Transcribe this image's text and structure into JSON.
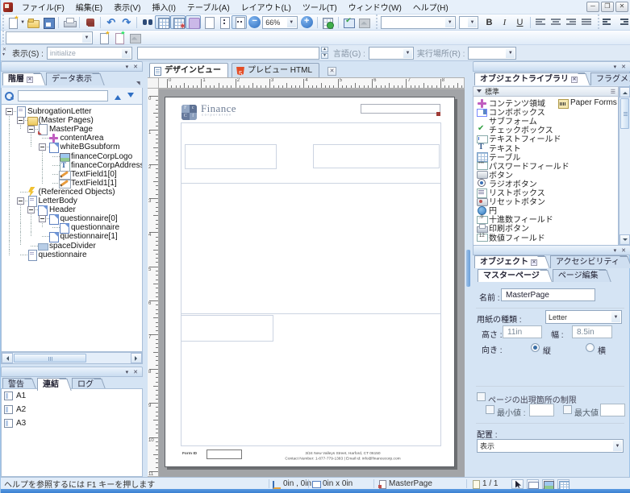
{
  "menu": {
    "items": [
      "ファイル(F)",
      "編集(E)",
      "表示(V)",
      "挿入(I)",
      "テーブル(A)",
      "レイアウト(L)",
      "ツール(T)",
      "ウィンドウ(W)",
      "ヘルプ(H)"
    ]
  },
  "toolbar": {
    "zoom_value": "66%",
    "bold": "B",
    "italic": "I",
    "underline": "U"
  },
  "script_bar": {
    "show_label": "表示(S) :",
    "show_value": "initialize",
    "language_label": "言語(G) :",
    "runat_label": "実行場所(R) :"
  },
  "hierarchy_panel": {
    "tabs": [
      "階層",
      "データ表示"
    ],
    "active_tab": 0,
    "tree": [
      {
        "label": "SubrogationLetter",
        "level": 1,
        "icon": "doc",
        "exp": true
      },
      {
        "label": "(Master Pages)",
        "level": 2,
        "icon": "folder",
        "exp": true
      },
      {
        "label": "MasterPage",
        "level": 3,
        "icon": "mpage",
        "exp": true
      },
      {
        "label": "contentArea",
        "level": 4,
        "icon": "carea",
        "exp": false
      },
      {
        "label": "whiteBGsubform",
        "level": 4,
        "icon": "subform",
        "exp": true
      },
      {
        "label": "financeCorpLogo",
        "level": 5,
        "icon": "img",
        "exp": false
      },
      {
        "label": "financeCorpAddress",
        "level": 5,
        "icon": "taddr",
        "exp": false
      },
      {
        "label": "TextField1[0]",
        "level": 5,
        "icon": "tfield",
        "exp": false
      },
      {
        "label": "TextField1[1]",
        "level": 5,
        "icon": "tfield",
        "exp": false
      },
      {
        "label": "(Referenced Objects)",
        "level": 2,
        "icon": "bolt",
        "exp": false
      },
      {
        "label": "LetterBody",
        "level": 2,
        "icon": "doc",
        "exp": true
      },
      {
        "label": "Header",
        "level": 3,
        "icon": "subform",
        "exp": true
      },
      {
        "label": "questionnaire[0]",
        "level": 4,
        "icon": "subform",
        "exp": true
      },
      {
        "label": "questionnaire",
        "level": 5,
        "icon": "subform",
        "exp": false
      },
      {
        "label": "questionnaire[1]",
        "level": 4,
        "icon": "subform",
        "exp": false
      },
      {
        "label": "spaceDivider",
        "level": 3,
        "icon": "rect",
        "exp": false
      },
      {
        "label": "questionnaire",
        "level": 2,
        "icon": "doc",
        "exp": false
      }
    ]
  },
  "report_panel": {
    "tabs": [
      "警告",
      "連結",
      "ログ"
    ],
    "active_tab": 1,
    "items": [
      "A1",
      "A2",
      "A3"
    ]
  },
  "document_tabs": {
    "design": "デザインビュー",
    "preview": "プレビュー HTML"
  },
  "page": {
    "logo_name": "Finance",
    "logo_sub": "corporation",
    "footer_label": "Form ID",
    "footer_line1": "3/24 New Valleys Street, Harford, CT 06150",
    "footer_line2": "Contact Number: 1-877-779-1383 | Email id: info@financecorp.com"
  },
  "library_panel": {
    "tabs": [
      "オブジェクトライブラリ",
      "フラグメントライブラリ"
    ],
    "active_tab": 0,
    "section": "標準",
    "items": [
      {
        "label": "コンテンツ領域",
        "icon": "carea2"
      },
      {
        "label": "コンボボックス",
        "icon": "combo"
      },
      {
        "label": "サブフォーム",
        "icon": "subform2"
      },
      {
        "label": "チェックボックス",
        "icon": "check"
      },
      {
        "label": "テキストフィールド",
        "icon": "tf"
      },
      {
        "label": "テキスト",
        "icon": "text"
      },
      {
        "label": "テーブル",
        "icon": "table"
      },
      {
        "label": "パスワードフィールド",
        "icon": "pass"
      },
      {
        "label": "ボタン",
        "icon": "btn"
      },
      {
        "label": "ラジオボタン",
        "icon": "radio"
      },
      {
        "label": "リストボックス",
        "icon": "list"
      },
      {
        "label": "リセットボタン",
        "icon": "reset"
      },
      {
        "label": "円",
        "icon": "circle"
      },
      {
        "label": "十進数フィールド",
        "icon": "dec"
      },
      {
        "label": "印刷ボタン",
        "icon": "print"
      },
      {
        "label": "数値フィールド",
        "icon": "num"
      }
    ],
    "col2_item": {
      "label": "Paper Forms Barc",
      "icon": "barcode"
    }
  },
  "object_panel": {
    "tabs": [
      "オブジェクト",
      "アクセシビリティ"
    ],
    "subtabs": [
      "マスターページ",
      "ページ編集"
    ],
    "name_label": "名前 :",
    "name_value": "MasterPage",
    "paper_label": "用紙の種類 :",
    "paper_value": "Letter",
    "height_label": "高さ :",
    "height_value": "11in",
    "width_label": "幅 :",
    "width_value": "8.5in",
    "orient_label": "向き :",
    "portrait": "縦",
    "landscape": "横",
    "occurrence_label": "ページの出現箇所の制限",
    "min_label": "最小値 :",
    "max_label": "最大値 :",
    "placement_label": "配置 :",
    "placement_value": "表示"
  },
  "status_bar": {
    "help": "ヘルプを参照するには F1 キーを押します",
    "pos": "0in , 0in",
    "size": "0in x 0in",
    "page_name": "MasterPage",
    "page_num": "1 / 1"
  }
}
